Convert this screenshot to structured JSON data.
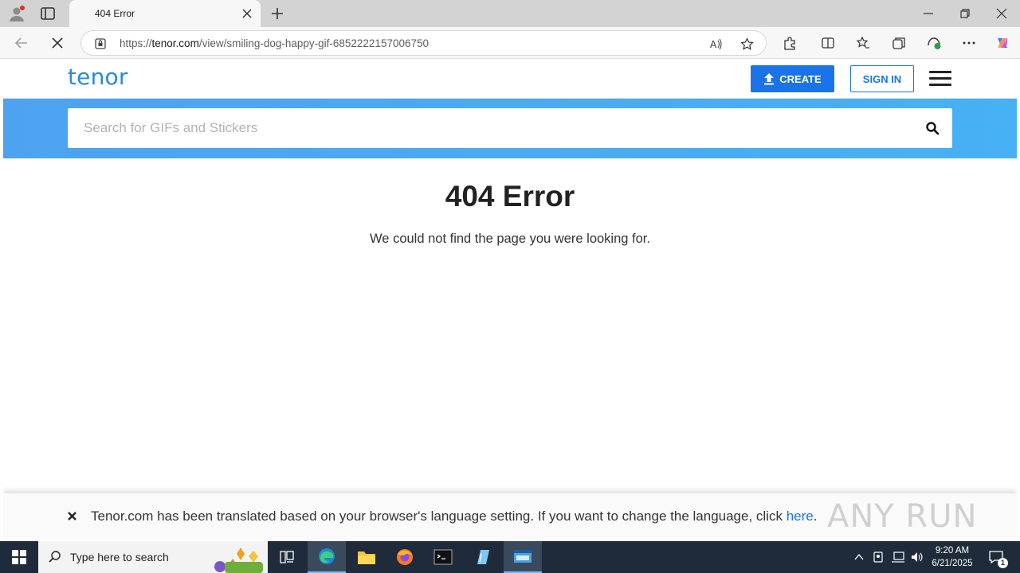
{
  "browser": {
    "tab_title": "404 Error",
    "url_prefix": "https://",
    "url_host": "tenor.com",
    "url_path": "/view/smiling-dog-happy-gif-6852222157006750"
  },
  "site": {
    "logo_text": "tenor",
    "create_label": "CREATE",
    "signin_label": "SIGN IN",
    "search_placeholder": "Search for GIFs and Stickers",
    "accent_color": "#1a73e8"
  },
  "error": {
    "title": "404 Error",
    "message": "We could not find the page you were looking for."
  },
  "translation_notice": {
    "text": "Tenor.com has been translated based on your browser's language setting. If you want to change the language, click ",
    "link_text": "here",
    "trailing": "."
  },
  "watermark": "ANY RUN",
  "taskbar": {
    "search_placeholder": "Type here to search",
    "time": "9:20 AM",
    "date": "6/21/2025",
    "notification_count": "1"
  }
}
